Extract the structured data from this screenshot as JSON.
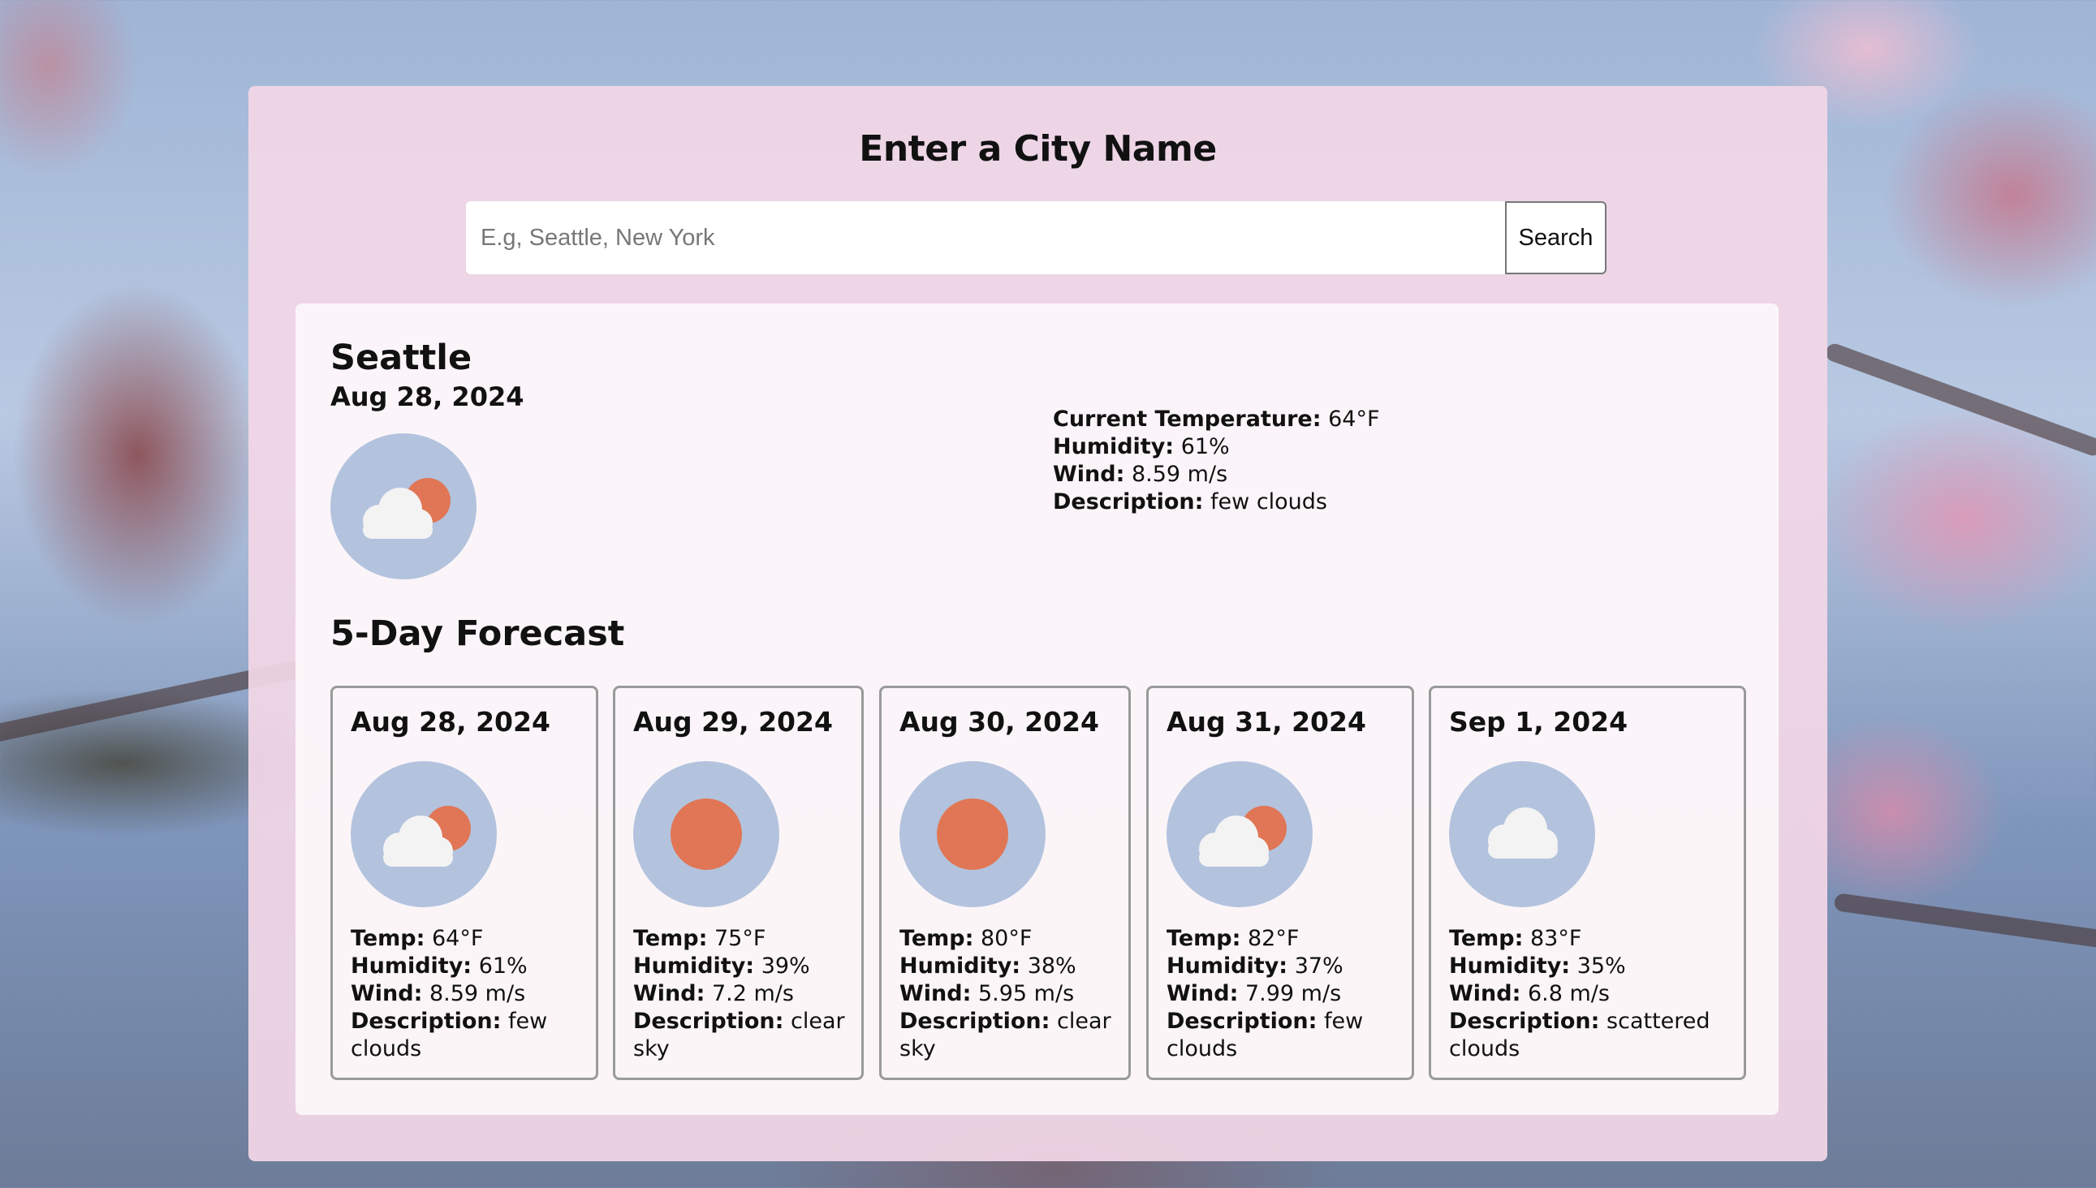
{
  "search": {
    "title": "Enter a City Name",
    "placeholder": "E.g, Seattle, New York",
    "value": "",
    "button_label": "Search"
  },
  "current": {
    "city": "Seattle",
    "date": "Aug 28, 2024",
    "icon": "few-clouds-icon",
    "temp_label": "Current Temperature:",
    "temp": "64°F",
    "humidity_label": "Humidity:",
    "humidity": "61%",
    "wind_label": "Wind:",
    "wind": "8.59 m/s",
    "description_label": "Description:",
    "description": "few clouds"
  },
  "forecast": {
    "title": "5-Day Forecast",
    "labels": {
      "temp": "Temp:",
      "humidity": "Humidity:",
      "wind": "Wind:",
      "description": "Description:"
    },
    "days": [
      {
        "date": "Aug 28, 2024",
        "icon": "few-clouds-icon",
        "temp": "64°F",
        "humidity": "61%",
        "wind": "8.59 m/s",
        "description": "few clouds"
      },
      {
        "date": "Aug 29, 2024",
        "icon": "clear-sky-icon",
        "temp": "75°F",
        "humidity": "39%",
        "wind": "7.2 m/s",
        "description": "clear sky"
      },
      {
        "date": "Aug 30, 2024",
        "icon": "clear-sky-icon",
        "temp": "80°F",
        "humidity": "38%",
        "wind": "5.95 m/s",
        "description": "clear sky"
      },
      {
        "date": "Aug 31, 2024",
        "icon": "few-clouds-icon",
        "temp": "82°F",
        "humidity": "37%",
        "wind": "7.99 m/s",
        "description": "few clouds"
      },
      {
        "date": "Sep 1, 2024",
        "icon": "scattered-clouds-icon",
        "temp": "83°F",
        "humidity": "35%",
        "wind": "6.8 m/s",
        "description": "scattered clouds"
      }
    ]
  },
  "colors": {
    "panel": "#f2d7e6",
    "card": "#fbf6f9",
    "icon_circle": "#b3c3de",
    "sun": "#e07655",
    "cloud": "#f3f3f3"
  }
}
